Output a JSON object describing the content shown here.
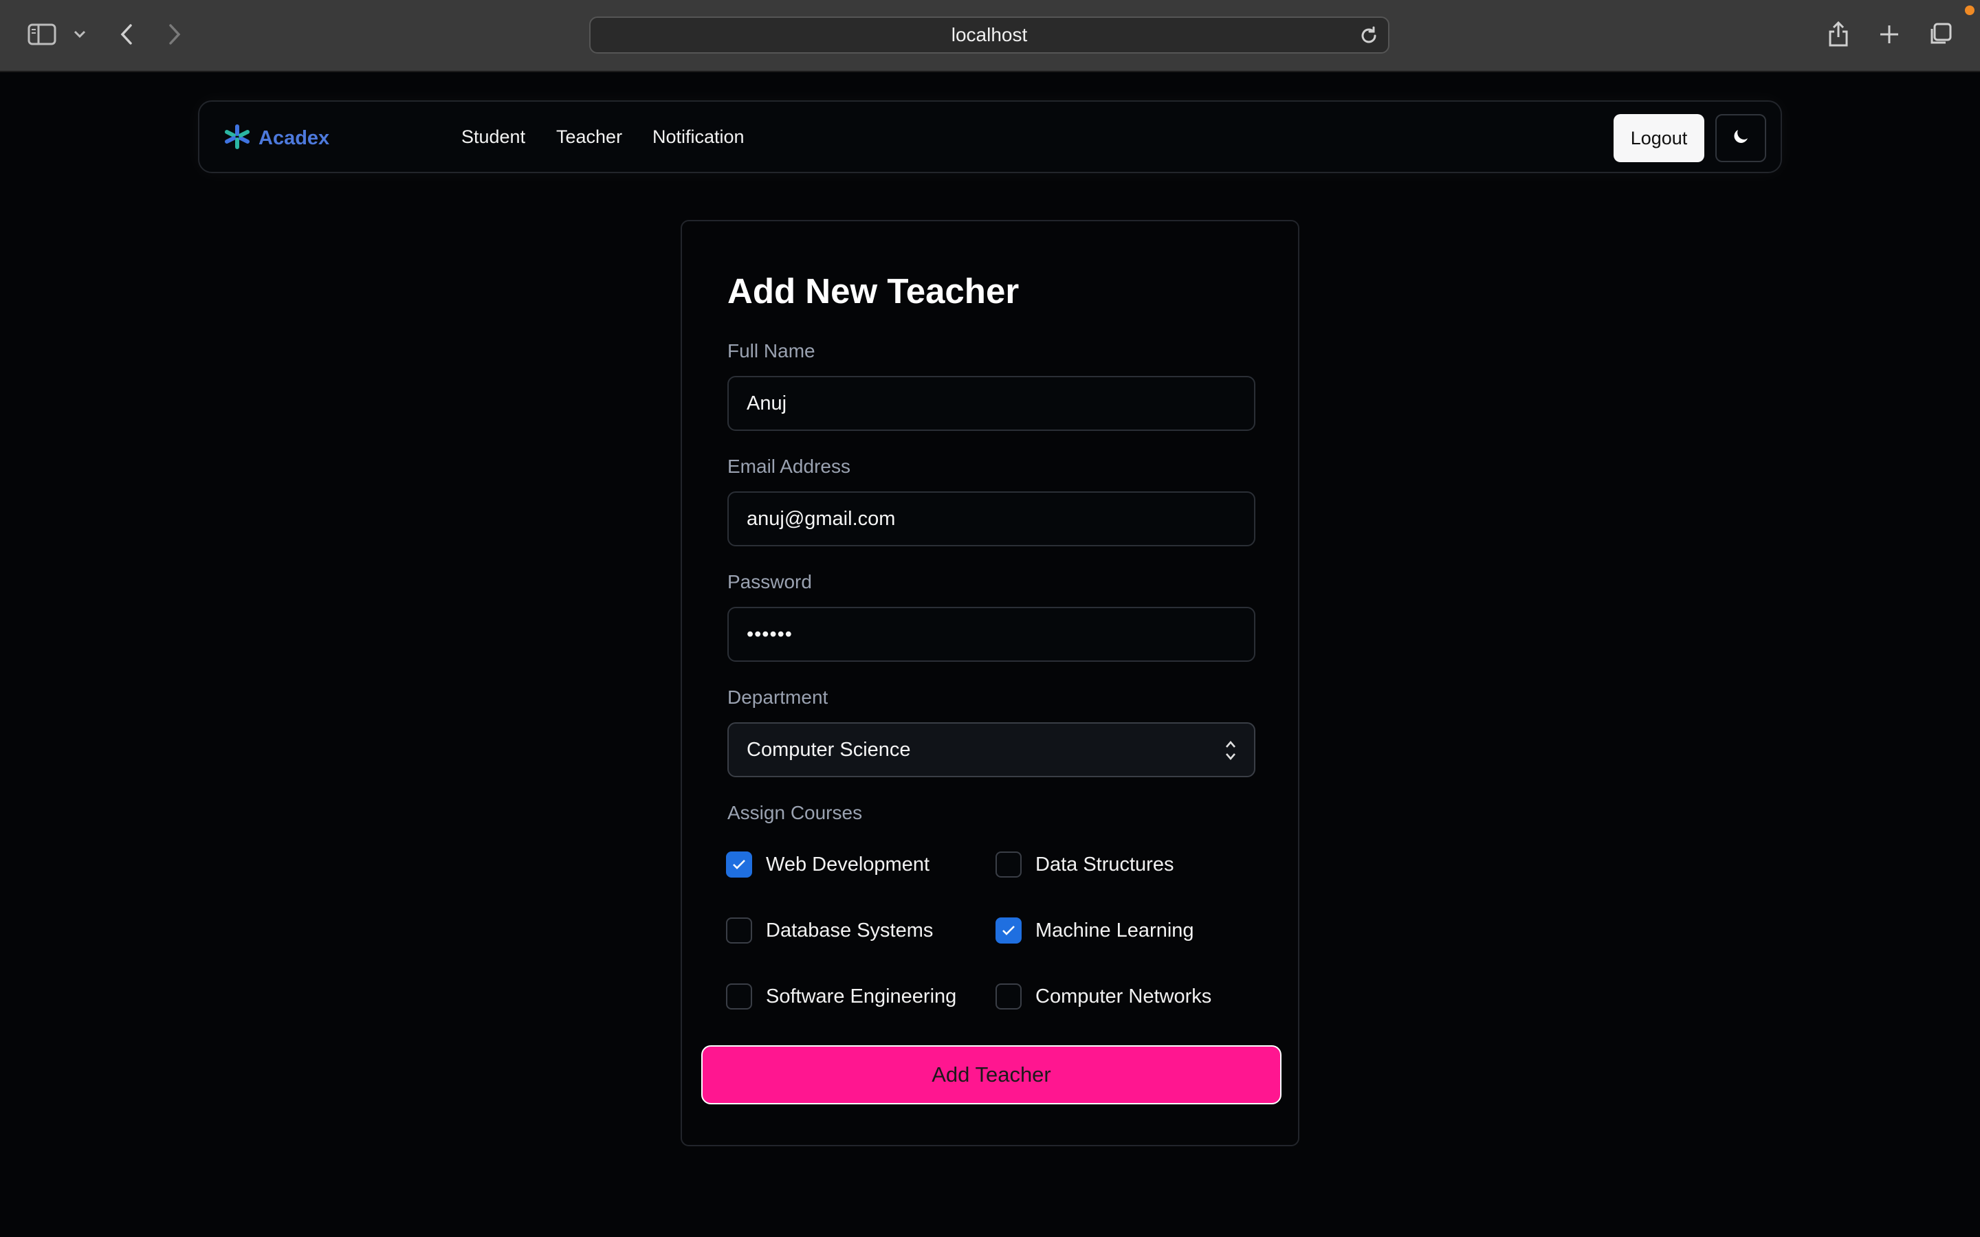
{
  "browser": {
    "url": "localhost",
    "icons": [
      "sidebar-icon",
      "chevron-down-icon",
      "back-icon",
      "forward-icon",
      "reload-icon",
      "share-icon",
      "new-tab-icon",
      "tabs-overview-icon"
    ]
  },
  "navbar": {
    "brand": "Acadex",
    "links": [
      "Student",
      "Teacher",
      "Notification"
    ],
    "logout_label": "Logout",
    "theme_icon": "moon-icon"
  },
  "form": {
    "title": "Add New Teacher",
    "full_name": {
      "label": "Full Name",
      "value": "Anuj"
    },
    "email": {
      "label": "Email Address",
      "value": "anuj@gmail.com"
    },
    "password": {
      "label": "Password",
      "value": "••••••"
    },
    "department": {
      "label": "Department",
      "value": "Computer Science"
    },
    "courses": {
      "label": "Assign Courses",
      "items": [
        {
          "label": "Web Development",
          "checked": true
        },
        {
          "label": "Data Structures",
          "checked": false
        },
        {
          "label": "Database Systems",
          "checked": false
        },
        {
          "label": "Machine Learning",
          "checked": true
        },
        {
          "label": "Software Engineering",
          "checked": false
        },
        {
          "label": "Computer Networks",
          "checked": false
        }
      ]
    },
    "submit_label": "Add Teacher"
  },
  "colors": {
    "accent": "#ff1690",
    "checkbox": "#1f6fe0",
    "brand": "#4d79dc",
    "background": "#040507"
  }
}
